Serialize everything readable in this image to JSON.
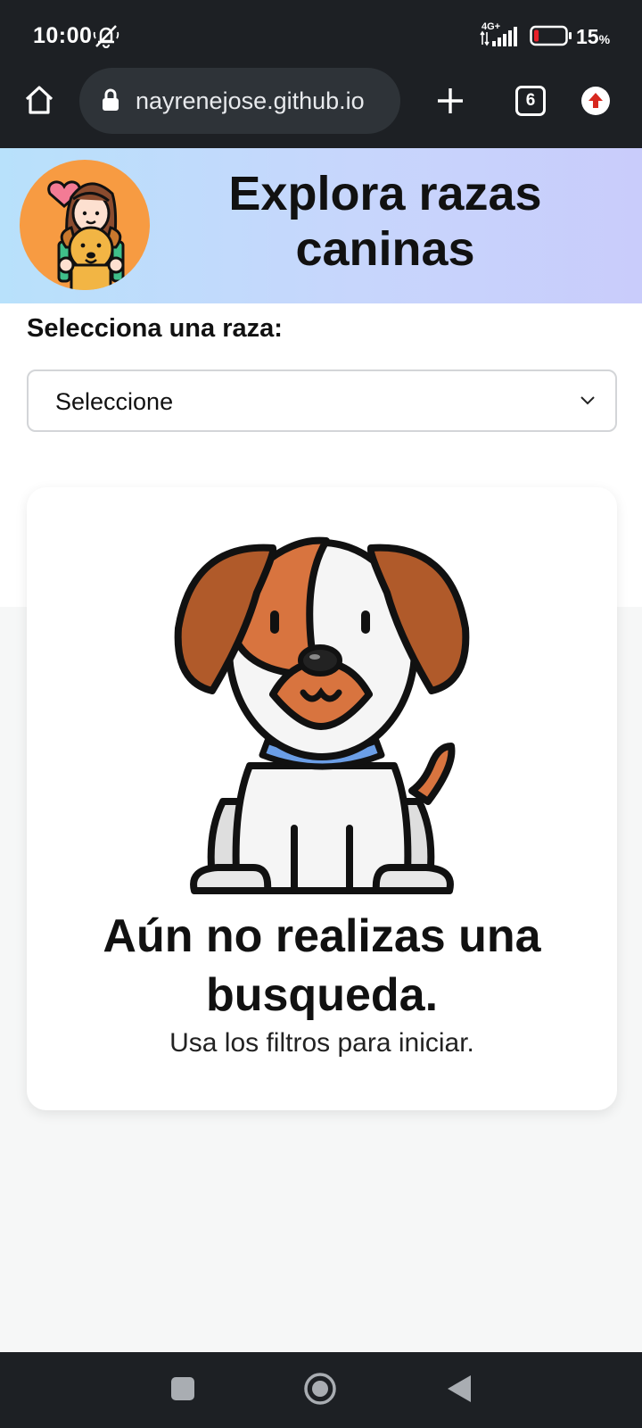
{
  "status_bar": {
    "time": "10:00",
    "network": "4G+",
    "battery_percent": "15",
    "battery_unit": "%",
    "battery_level": 0.15
  },
  "browser": {
    "url": "nayrenejose.github.io",
    "tab_count": "6",
    "icons": [
      "home-icon",
      "lock-icon",
      "new-tab-icon",
      "tabs-icon",
      "update-icon"
    ]
  },
  "header": {
    "title": "Explora razas caninas"
  },
  "filter": {
    "label": "Selecciona una raza:",
    "selected": "Seleccione"
  },
  "empty_state": {
    "title": "Aún no realizas una busqueda.",
    "subtitle": "Usa los filtros para iniciar."
  },
  "colors": {
    "system_bar": "#1d2024",
    "header_gradient_start": "#b8e1fb",
    "header_gradient_end": "#c9ccfb",
    "avatar_bg": "#f79b42",
    "page_bg": "#f6f7f7"
  }
}
